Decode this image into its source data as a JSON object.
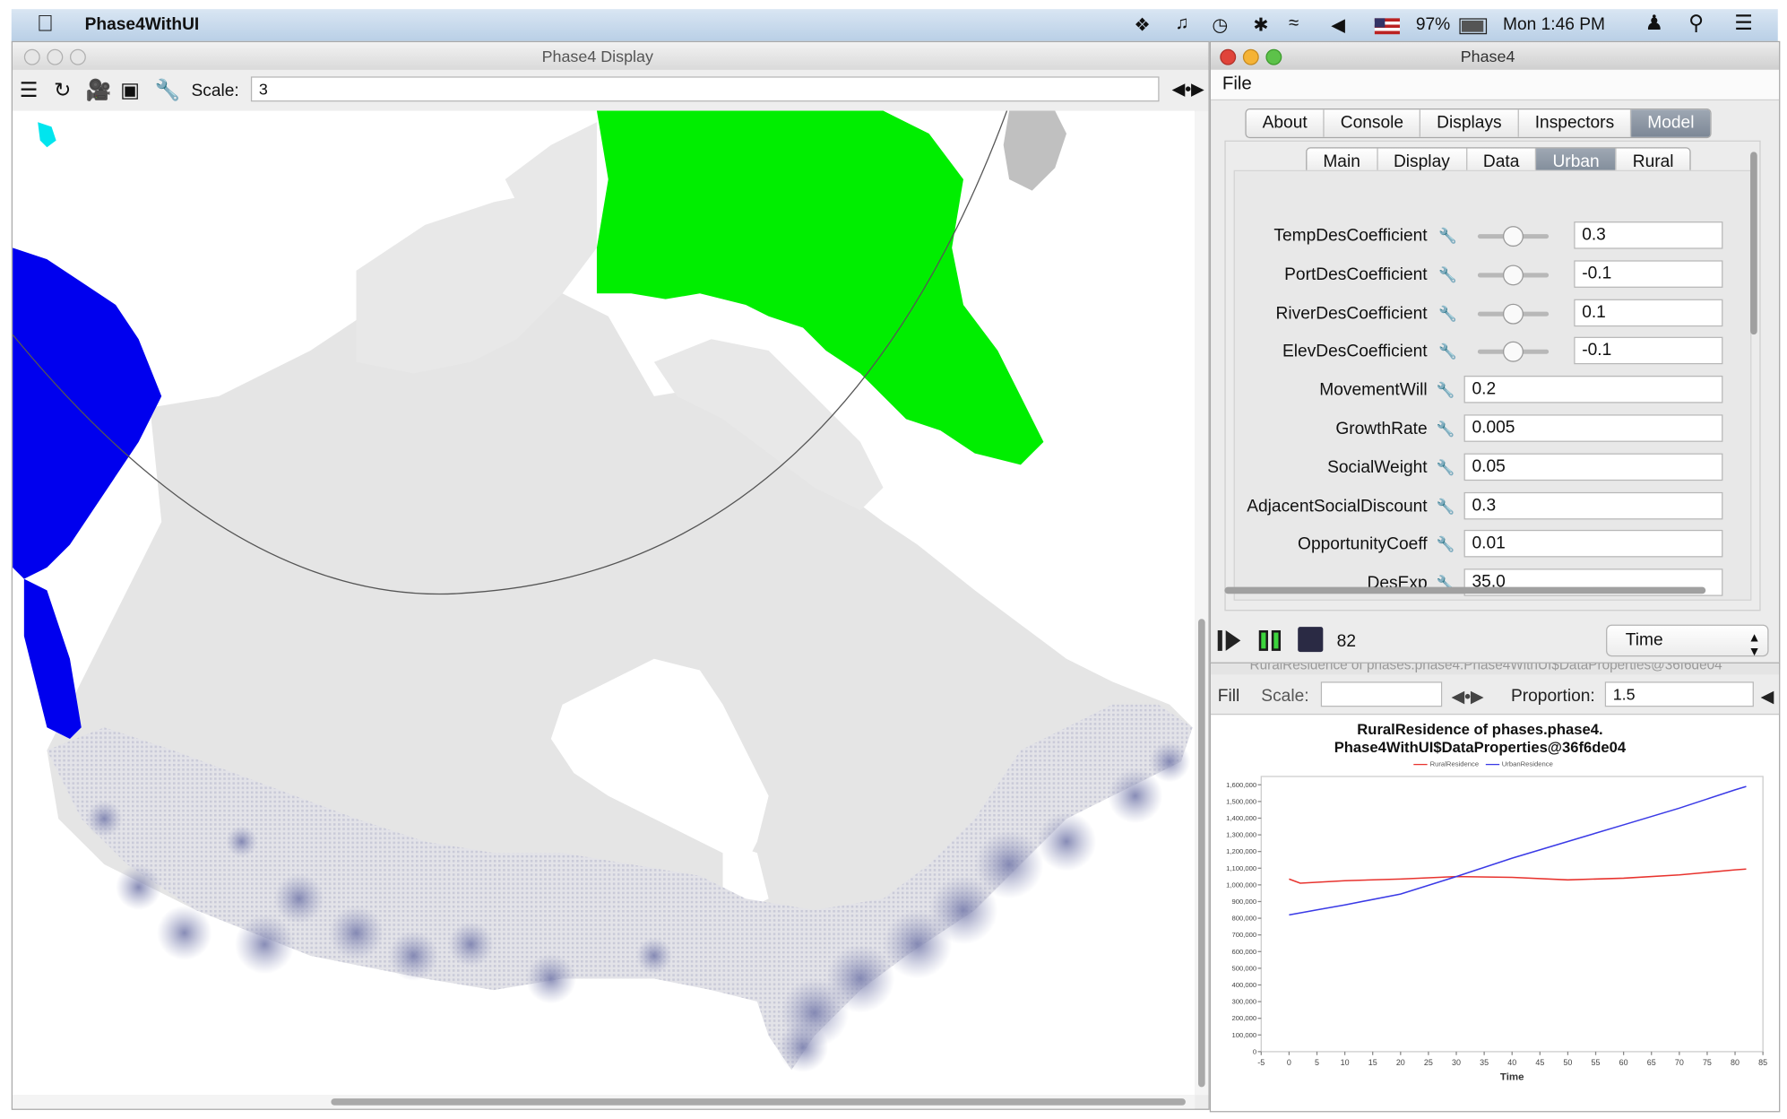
{
  "menubar": {
    "app_name": "Phase4WithUI",
    "battery": "97%",
    "clock": "Mon 1:46 PM",
    "icons": [
      "apple-icon",
      "dropbox-icon",
      "bell-icon",
      "time-machine-icon",
      "bluetooth-icon",
      "wifi-icon",
      "volume-icon",
      "flag-icon",
      "battery-icon",
      "user-icon",
      "spotlight-icon",
      "notification-list-icon"
    ]
  },
  "display_window": {
    "title": "Phase4 Display",
    "scale_label": "Scale:",
    "scale_value": "3",
    "toolbar_icons": [
      "layers-icon",
      "refresh-icon",
      "movie-camera-icon",
      "snapshot-camera-icon",
      "wrench-icon"
    ]
  },
  "control_window": {
    "title": "Phase4",
    "menu_file": "File",
    "tabs": [
      "About",
      "Console",
      "Displays",
      "Inspectors",
      "Model"
    ],
    "selected_tab": "Model",
    "subtabs": [
      "Main",
      "Display",
      "Data",
      "Urban",
      "Rural"
    ],
    "selected_subtab": "Urban",
    "params": [
      {
        "label": "TempDesCoefficient",
        "value": "0.3",
        "slider": true
      },
      {
        "label": "PortDesCoefficient",
        "value": "-0.1",
        "slider": true
      },
      {
        "label": "RiverDesCoefficient",
        "value": "0.1",
        "slider": true
      },
      {
        "label": "ElevDesCoefficient",
        "value": "-0.1",
        "slider": true
      },
      {
        "label": "MovementWill",
        "value": "0.2",
        "slider": false
      },
      {
        "label": "GrowthRate",
        "value": "0.005",
        "slider": false
      },
      {
        "label": "SocialWeight",
        "value": "0.05",
        "slider": false
      },
      {
        "label": "AdjacentSocialDiscount",
        "value": "0.3",
        "slider": false
      },
      {
        "label": "OpportunityCoeff",
        "value": "0.01",
        "slider": false
      },
      {
        "label": "DesExp",
        "value": "35.0",
        "slider": false
      }
    ],
    "steps": "82",
    "time_select": "Time"
  },
  "chart_window": {
    "hidden_title": "RuralResidence of phases.phase4.Phase4WithUI$DataProperties@36f6de04",
    "fill_label": "Fill",
    "scale_label": "Scale:",
    "scale_value": "",
    "proportion_label": "Proportion:",
    "proportion_value": "1.5",
    "title_line1": "RuralResidence of phases.phase4.",
    "title_line2": "Phase4WithUI$DataProperties@36f6de04",
    "colors": {
      "rural": "#e8332e",
      "urban": "#3a3ae6"
    }
  },
  "chart_data": {
    "type": "line",
    "xlabel": "Time",
    "ylabel": "",
    "xlim": [
      -5,
      85
    ],
    "ylim": [
      0,
      1650000
    ],
    "xticks": [
      "-5",
      "0",
      "5",
      "10",
      "15",
      "20",
      "25",
      "30",
      "35",
      "40",
      "45",
      "50",
      "55",
      "60",
      "65",
      "70",
      "75",
      "80",
      "85"
    ],
    "yticks": [
      "0",
      "100,000",
      "200,000",
      "300,000",
      "400,000",
      "500,000",
      "600,000",
      "700,000",
      "800,000",
      "900,000",
      "1,000,000",
      "1,100,000",
      "1,200,000",
      "1,300,000",
      "1,400,000",
      "1,500,000",
      "1,600,000"
    ],
    "series": [
      {
        "name": "RuralResidence",
        "x": [
          0,
          2,
          10,
          20,
          30,
          40,
          50,
          60,
          70,
          80,
          82
        ],
        "y": [
          1035000,
          1010000,
          1025000,
          1035000,
          1050000,
          1045000,
          1030000,
          1040000,
          1060000,
          1090000,
          1095000
        ]
      },
      {
        "name": "UrbanResidence",
        "x": [
          0,
          5,
          10,
          20,
          30,
          40,
          50,
          60,
          70,
          80,
          82
        ],
        "y": [
          820000,
          850000,
          880000,
          945000,
          1050000,
          1160000,
          1260000,
          1360000,
          1460000,
          1570000,
          1590000
        ]
      }
    ]
  }
}
